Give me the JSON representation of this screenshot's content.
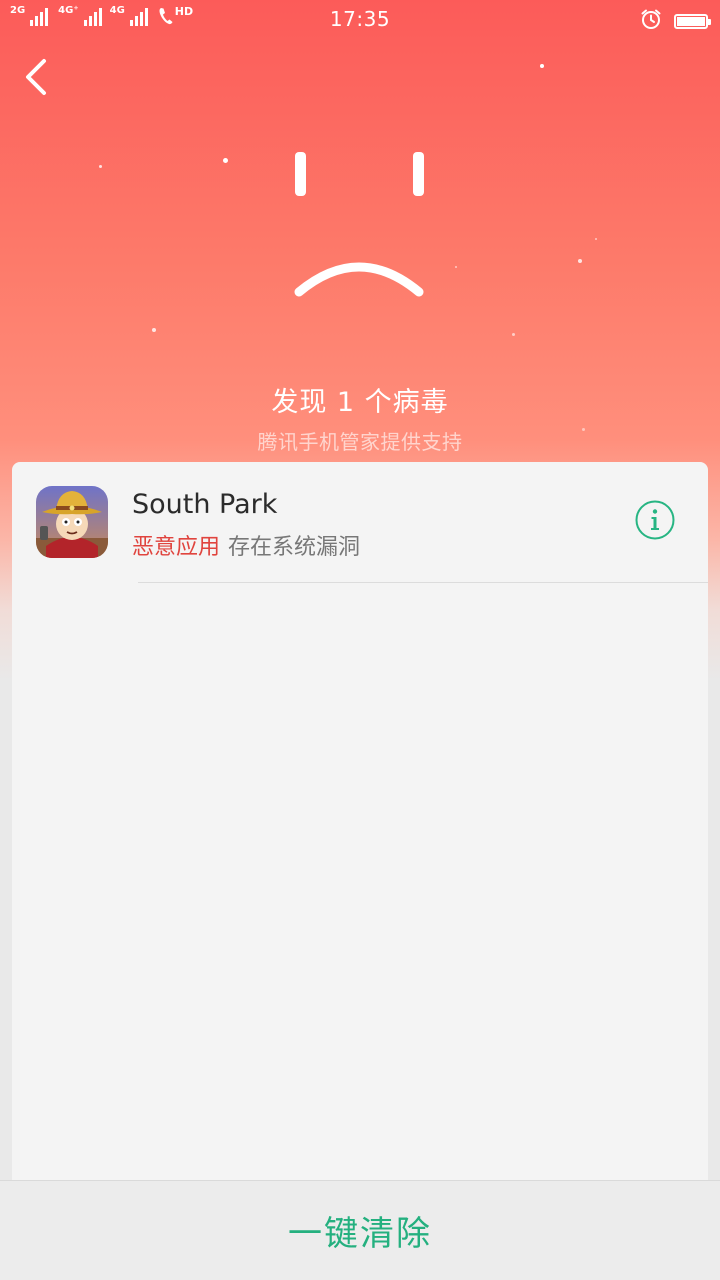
{
  "status_bar": {
    "network_1": "2G",
    "network_2": "4G⁺",
    "network_3": "4G",
    "hd_label": "HD",
    "time": "17:35",
    "icons": [
      "signal-icon",
      "phone-hd-icon",
      "alarm-icon",
      "battery-icon"
    ]
  },
  "header": {
    "back_icon": "chevron-left-icon",
    "face_icon": "sad-face-icon",
    "title": "发现 1 个病毒",
    "subtitle": "腾讯手机管家提供支持"
  },
  "threats": [
    {
      "app_name": "South Park",
      "tag": "恶意应用",
      "description": "存在系统漏洞",
      "icon": "south-park-app-icon",
      "info_icon": "info-icon"
    }
  ],
  "footer": {
    "clear_label": "一键清除"
  },
  "colors": {
    "hero_top": "#fc5b59",
    "hero_bottom": "#ff8f7c",
    "danger": "#e0443e",
    "accent_green": "#24b07f",
    "card_bg": "#f4f4f4"
  }
}
